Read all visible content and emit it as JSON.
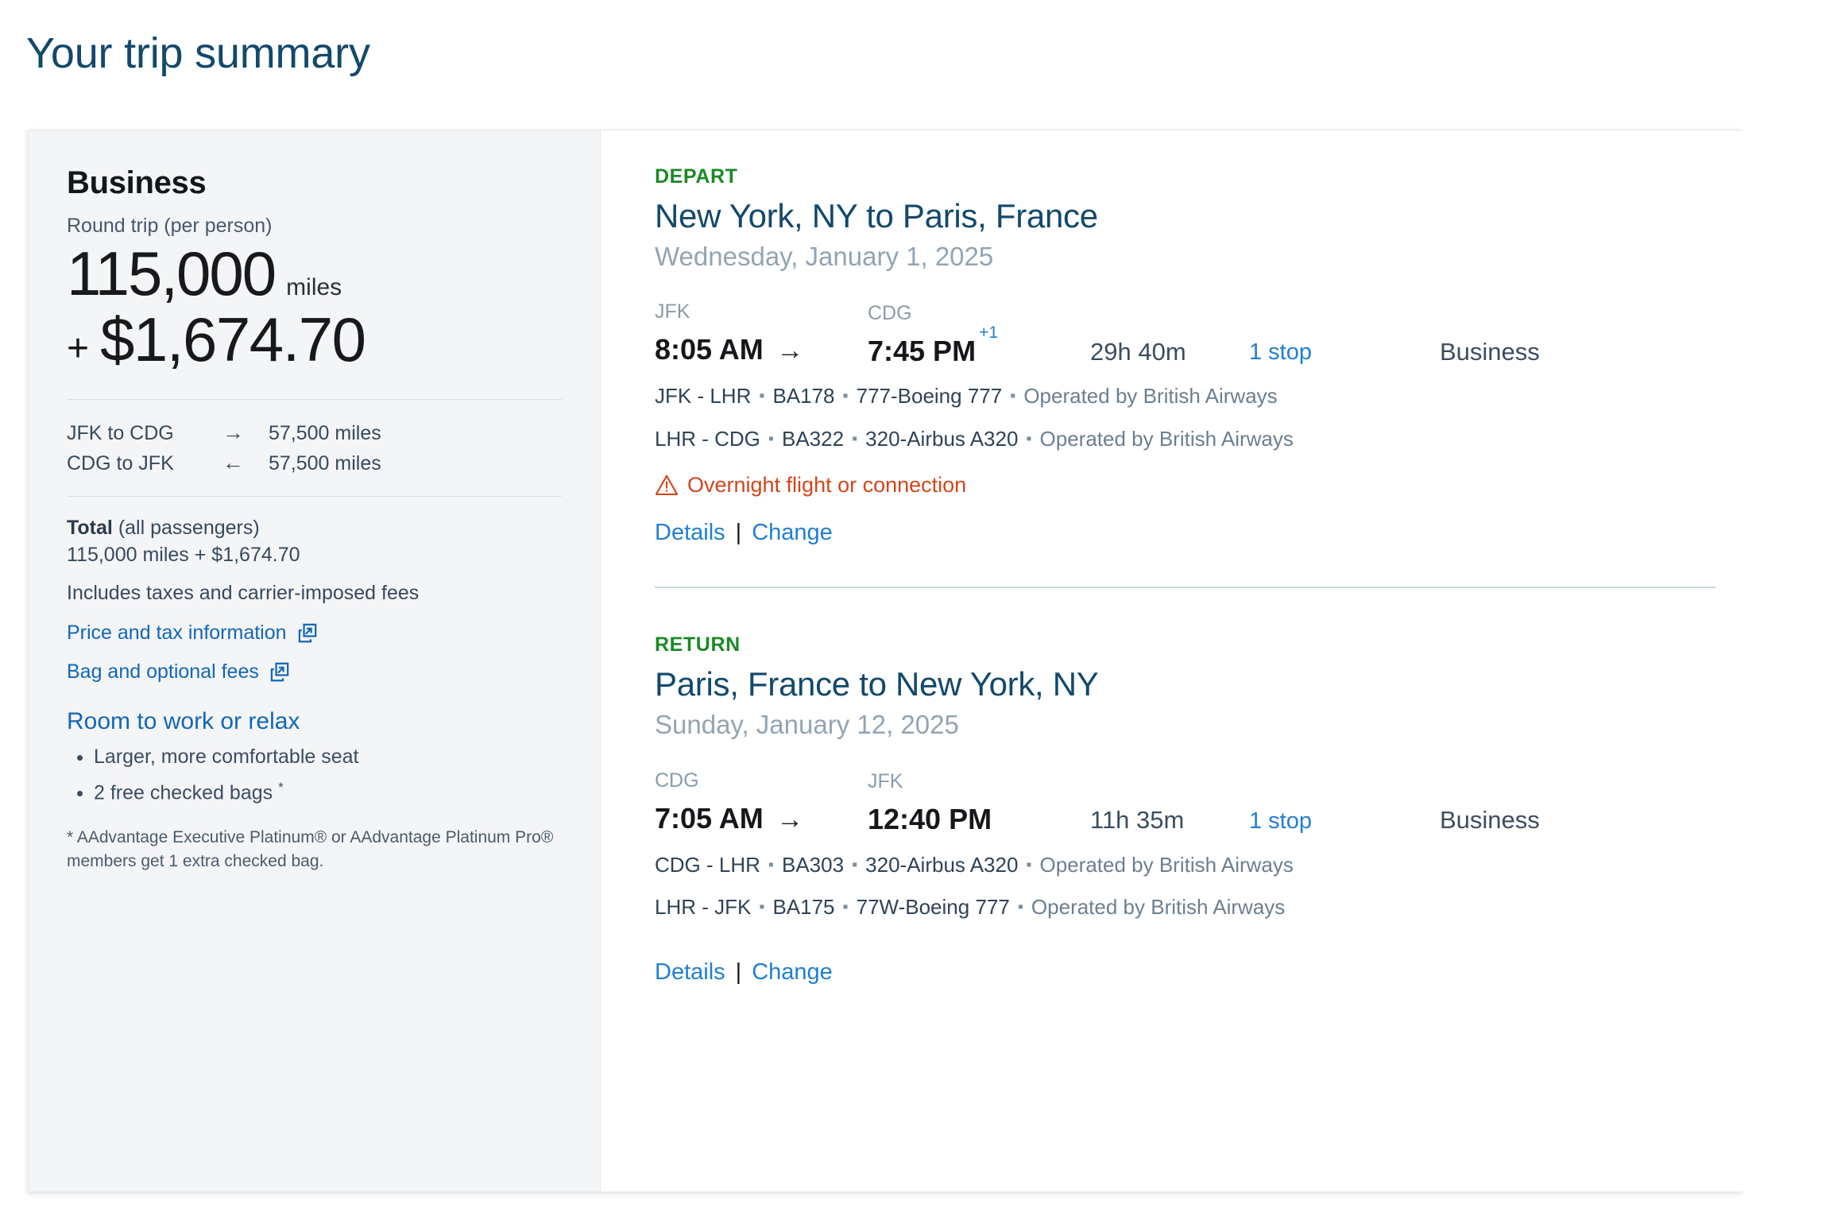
{
  "page": {
    "title": "Your trip summary"
  },
  "summary": {
    "cabin": "Business",
    "round_trip_label": "Round trip (per person)",
    "miles_amount": "115,000",
    "miles_unit": "miles",
    "cash_plus": "+",
    "cash_amount": "$1,674.70",
    "legs": [
      {
        "name": "JFK to CDG",
        "arrow": "→",
        "miles": "57,500 miles"
      },
      {
        "name": "CDG to JFK",
        "arrow": "←",
        "miles": "57,500 miles"
      }
    ],
    "total_word": "Total",
    "total_qualifier": " (all passengers)",
    "total_values": "115,000 miles + $1,674.70",
    "includes_line": "Includes taxes and carrier-imposed fees",
    "links": [
      {
        "label": "Price and tax information",
        "icon": "external-link-icon"
      },
      {
        "label": "Bag and optional fees",
        "icon": "external-link-icon"
      }
    ],
    "perks_title": "Room to work or relax",
    "perks": [
      {
        "text": "Larger, more comfortable seat",
        "marker": ""
      },
      {
        "text": "2 free checked bags ",
        "marker": "*"
      }
    ],
    "footnote": "* AAdvantage Executive Platinum® or AAdvantage Platinum Pro® members get 1 extra checked bag."
  },
  "itinerary": {
    "slices": [
      {
        "kicker": "DEPART",
        "route": "New York, NY to Paris, France",
        "date": "Wednesday, January 1, 2025",
        "origin_code": "JFK",
        "dest_code": "CDG",
        "depart_time": "8:05 AM",
        "arrive_time": "7:45 PM",
        "plus_day": "+1",
        "arrow": "→",
        "duration": "29h 40m",
        "stops": "1 stop",
        "cabin": "Business",
        "segments": [
          {
            "route": "JFK - LHR",
            "flight": "BA178",
            "aircraft": "777-Boeing 777",
            "operated": "Operated by British Airways"
          },
          {
            "route": "LHR - CDG",
            "flight": "BA322",
            "aircraft": "320-Airbus A320",
            "operated": "Operated by British Airways"
          }
        ],
        "alert": "Overnight flight or connection",
        "alert_icon": "warning-triangle-icon",
        "details_label": "Details",
        "change_label": "Change"
      },
      {
        "kicker": "RETURN",
        "route": "Paris, France to New York, NY",
        "date": "Sunday, January 12, 2025",
        "origin_code": "CDG",
        "dest_code": "JFK",
        "depart_time": "7:05 AM",
        "arrive_time": "12:40 PM",
        "plus_day": "",
        "arrow": "→",
        "duration": "11h 35m",
        "stops": "1 stop",
        "cabin": "Business",
        "segments": [
          {
            "route": "CDG - LHR",
            "flight": "BA303",
            "aircraft": "320-Airbus A320",
            "operated": "Operated by British Airways"
          },
          {
            "route": "LHR - JFK",
            "flight": "BA175",
            "aircraft": "77W-Boeing 777",
            "operated": "Operated by British Airways"
          }
        ],
        "alert": "",
        "alert_icon": "",
        "details_label": "Details",
        "change_label": "Change"
      }
    ],
    "segment_separator": "▪"
  },
  "colors": {
    "brand_blue": "#12496d",
    "link_blue": "#1f7fd4",
    "depart_green": "#1a8a25",
    "alert_orange": "#d4451a",
    "panel_bg": "#f4f5f7"
  }
}
